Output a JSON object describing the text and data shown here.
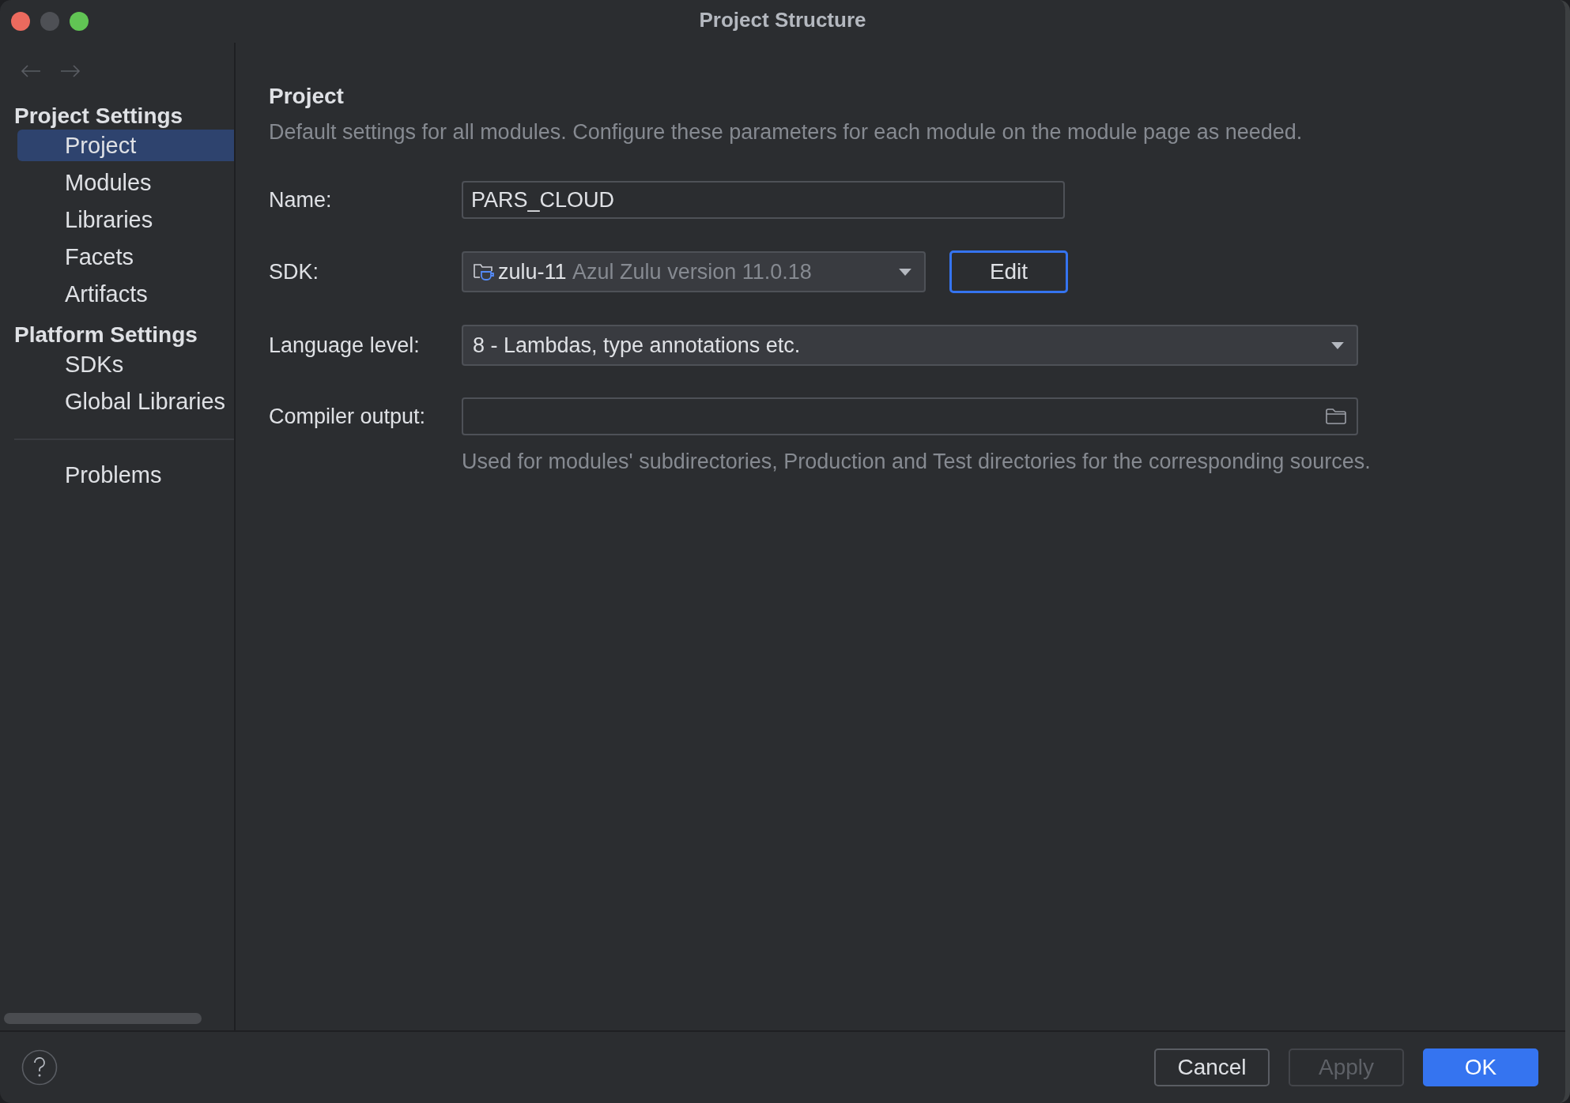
{
  "window": {
    "title": "Project Structure"
  },
  "sidebar": {
    "sections": [
      {
        "title": "Project Settings",
        "items": [
          {
            "label": "Project",
            "selected": true
          },
          {
            "label": "Modules",
            "selected": false
          },
          {
            "label": "Libraries",
            "selected": false
          },
          {
            "label": "Facets",
            "selected": false
          },
          {
            "label": "Artifacts",
            "selected": false
          }
        ]
      },
      {
        "title": "Platform Settings",
        "items": [
          {
            "label": "SDKs",
            "selected": false
          },
          {
            "label": "Global Libraries",
            "selected": false
          }
        ]
      }
    ],
    "footer_items": [
      {
        "label": "Problems",
        "selected": false
      }
    ]
  },
  "main": {
    "heading": "Project",
    "description": "Default settings for all modules. Configure these parameters for each module on the module page as needed.",
    "fields": [
      {
        "kind": "text",
        "label": "Name:",
        "value": "PARS_CLOUD"
      },
      {
        "kind": "sdk",
        "label": "SDK:",
        "value": "zulu-11",
        "detail": "Azul Zulu version 11.0.18",
        "button": {
          "label": "Edit",
          "focused": true
        }
      },
      {
        "kind": "dropdown",
        "label": "Language level:",
        "value": "8 - Lambdas, type annotations etc."
      },
      {
        "kind": "path",
        "label": "Compiler output:",
        "hint": "Used for modules' subdirectories, Production and Test directories for the corresponding sources."
      }
    ]
  },
  "buttons": [
    {
      "label": "Cancel",
      "kind": "normal",
      "disabled": false
    },
    {
      "label": "Apply",
      "kind": "normal",
      "disabled": true
    },
    {
      "label": "OK",
      "kind": "primary",
      "disabled": false
    }
  ]
}
